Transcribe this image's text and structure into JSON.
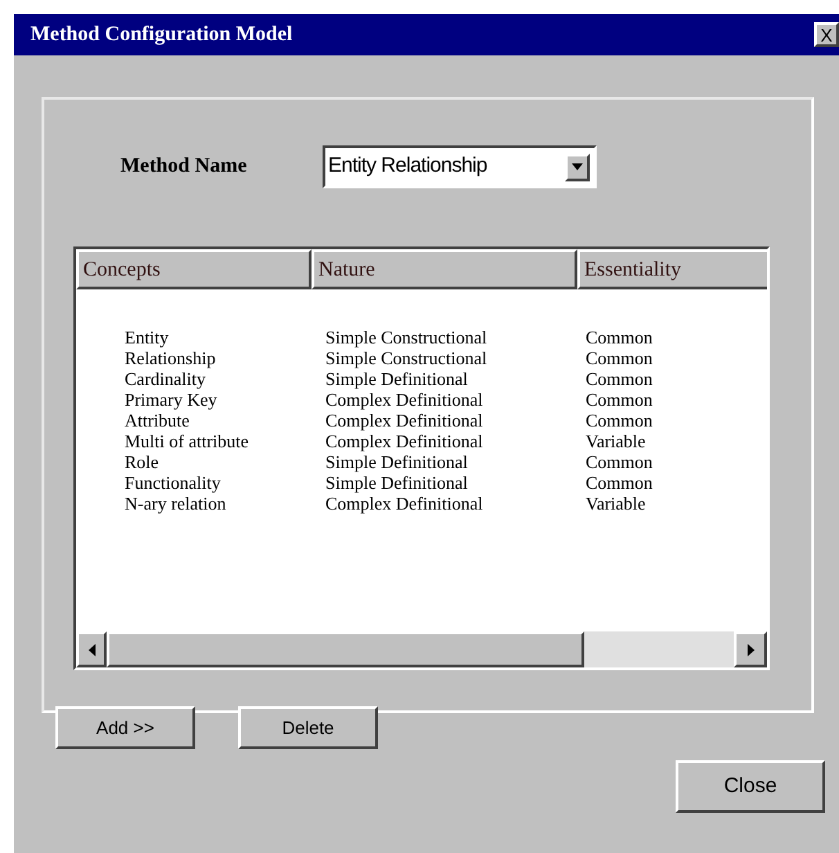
{
  "window": {
    "title": "Method Configuration Model",
    "close": "X"
  },
  "method_name": {
    "label": "Method Name",
    "value": "Entity Relationship"
  },
  "table": {
    "columns": [
      "Concepts",
      "Nature",
      "Essentiality"
    ],
    "rows": [
      [
        "Entity",
        "Simple Constructional",
        "Common"
      ],
      [
        "Relationship",
        "Simple Constructional",
        "Common"
      ],
      [
        "Cardinality",
        "Simple Definitional",
        "Common"
      ],
      [
        "Primary Key",
        "Complex Definitional",
        "Common"
      ],
      [
        "Attribute",
        "Complex Definitional",
        "Common"
      ],
      [
        "Multi of attribute",
        "Complex Definitional",
        "Variable"
      ],
      [
        "Role",
        "Simple Definitional",
        "Common"
      ],
      [
        "Functionality",
        "Simple Definitional",
        "Common"
      ],
      [
        "N-ary relation",
        "Complex Definitional",
        "Variable"
      ]
    ]
  },
  "buttons": [
    "Add >>",
    "Delete"
  ],
  "close_button": "Close"
}
